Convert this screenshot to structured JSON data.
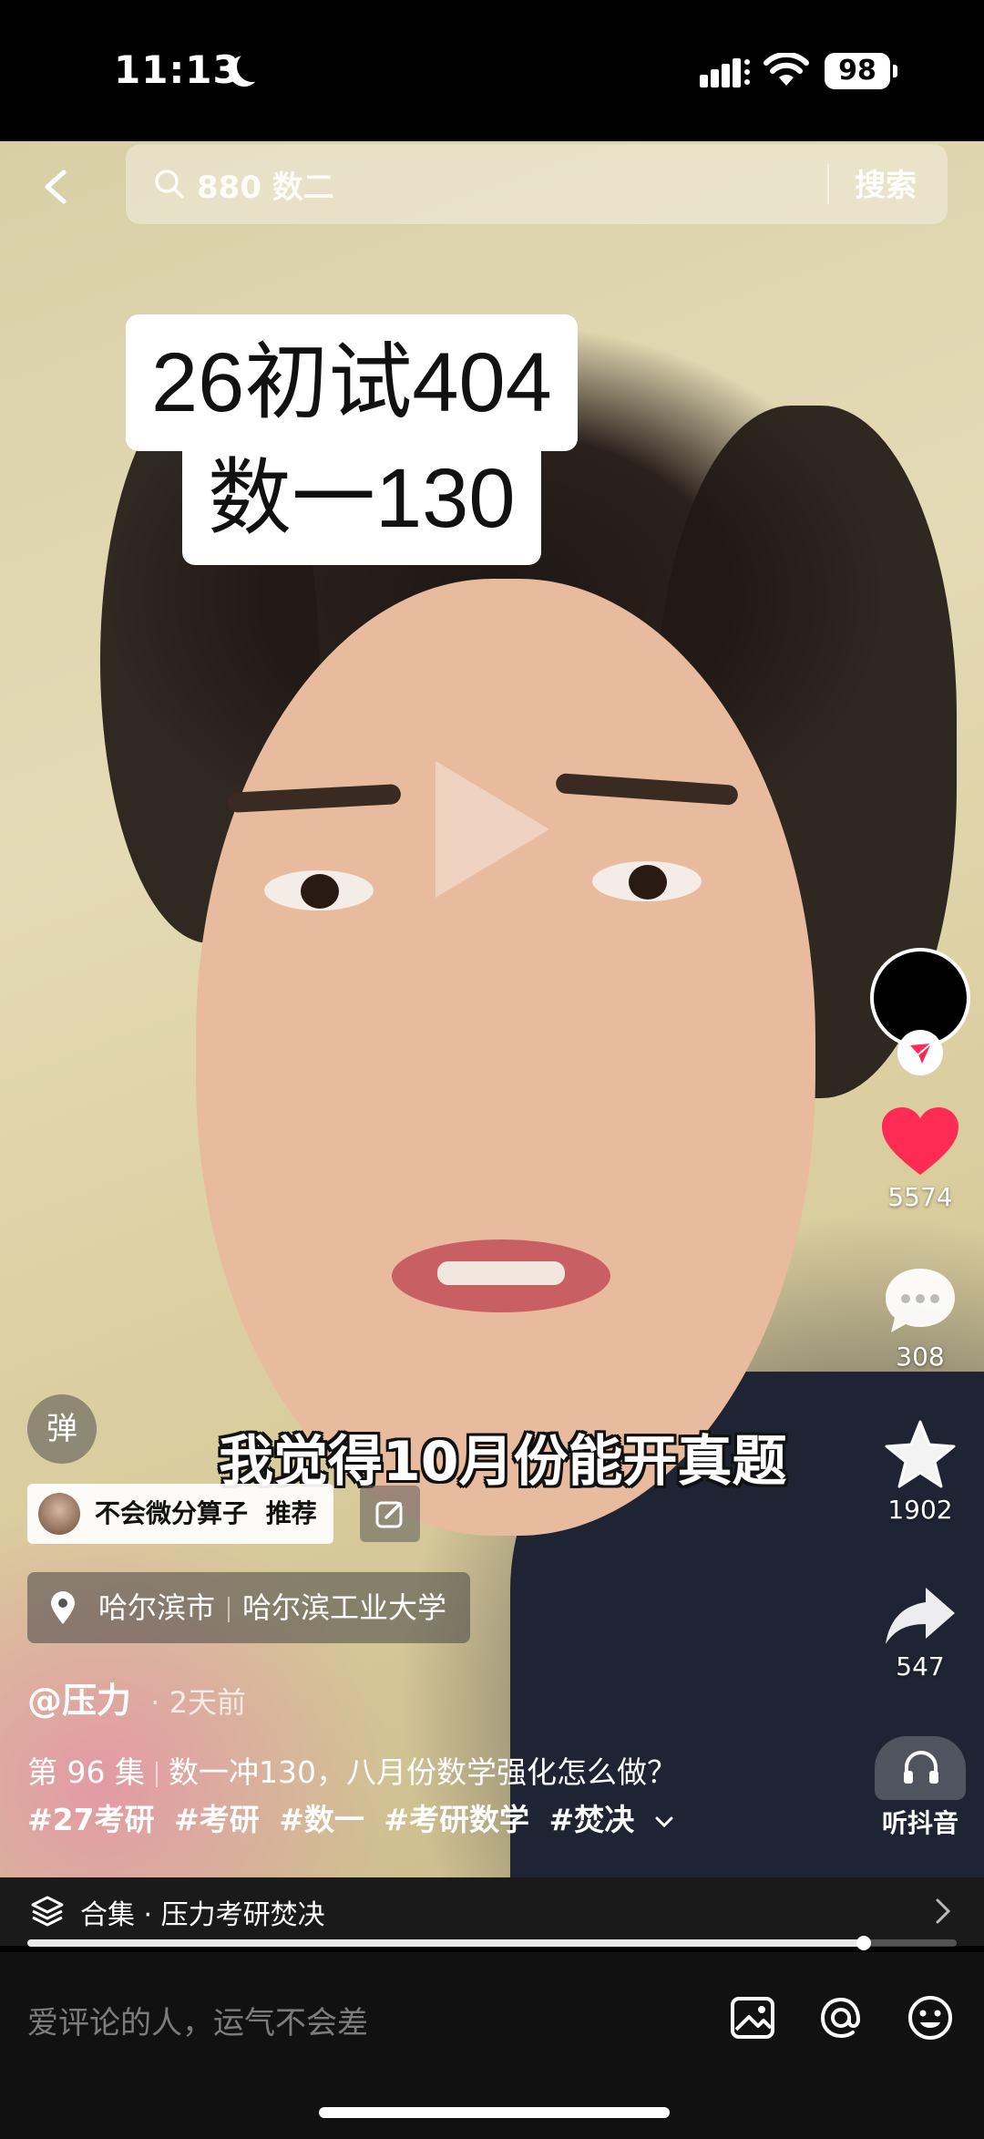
{
  "status_bar": {
    "time": "11:13",
    "battery": "98"
  },
  "search": {
    "query": "880 数二",
    "button_label": "搜索"
  },
  "video": {
    "title_line1": "26初试404",
    "title_line2": "数一130",
    "subtitle": "我觉得10月份能开真题"
  },
  "actions": {
    "likes": "5574",
    "comments": "308",
    "favorites": "1902",
    "shares": "547",
    "listen_label": "听抖音",
    "like_color": "#fe2c55"
  },
  "info": {
    "danmu_label": "弹",
    "recommend_name": "不会微分算子",
    "recommend_label": "推荐",
    "location_city": "哈尔滨市",
    "location_place": "哈尔滨工业大学",
    "author": "@压力",
    "posted": "· 2天前",
    "episode": "第 96 集",
    "description": "数一冲130，八月份数学强化怎么做？",
    "tags": [
      "#27考研",
      "#考研",
      "#数一",
      "#考研数学",
      "#焚决"
    ]
  },
  "collection": {
    "label": "合集 · 压力考研焚决",
    "progress": 0.9
  },
  "comment_bar": {
    "placeholder": "爱评论的人，运气不会差"
  }
}
